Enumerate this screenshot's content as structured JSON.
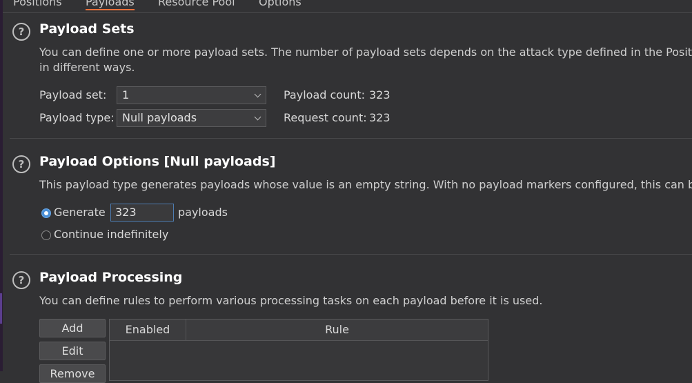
{
  "tabs": [
    "Positions",
    "Payloads",
    "Resource Pool",
    "Options"
  ],
  "payload_sets": {
    "title": "Payload Sets",
    "desc_line1": "You can define one or more payload sets. The number of payload sets depends on the attack type defined in the Position",
    "desc_line2": "in different ways.",
    "set_label": "Payload set:",
    "set_value": "1",
    "type_label": "Payload type:",
    "type_value": "Null payloads",
    "payload_count_label": "Payload count:",
    "payload_count": "323",
    "request_count_label": "Request count:",
    "request_count": "323"
  },
  "payload_options": {
    "title": "Payload Options [Null payloads]",
    "desc": "This payload type generates payloads whose value is an empty string. With no payload markers configured, this can be u",
    "generate_label": "Generate",
    "generate_value": "323",
    "payloads_suffix": "payloads",
    "continue_label": "Continue indefinitely"
  },
  "payload_processing": {
    "title": "Payload Processing",
    "desc": "You can define rules to perform various processing tasks on each payload before it is used.",
    "buttons": [
      "Add",
      "Edit",
      "Remove"
    ],
    "columns": [
      "Enabled",
      "Rule"
    ]
  },
  "colors": {
    "background": "#323234",
    "active_tab_underline": "#e8703a",
    "radio_selected": "#4a8fd6"
  }
}
